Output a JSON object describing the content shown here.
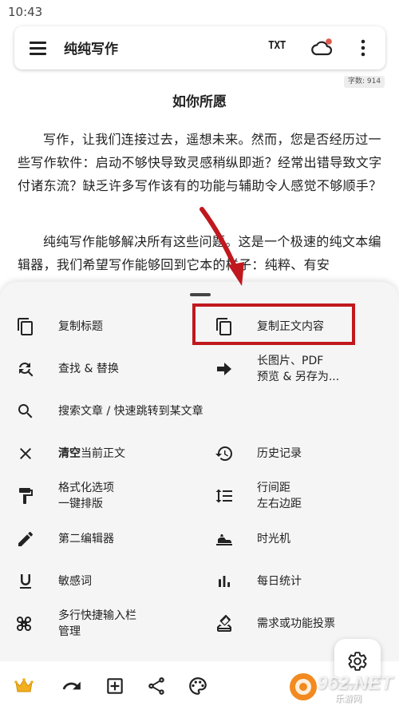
{
  "status_bar": {
    "time": "10:43"
  },
  "toolbar": {
    "title": "纯纯写作",
    "txt_label": "TXT",
    "cloud_has_notification": true,
    "notification_color": "#e05a4e"
  },
  "editor": {
    "word_count": "字数: 914",
    "title": "如你所愿",
    "paragraphs": [
      "写作，让我们连接过去，遥想未来。然而，您是否经历过一些写作软件：启动不够快导致灵感稍纵即逝？经常出错导致文字付诸东流？缺乏许多写作该有的功能与辅助令人感觉不够顺手？",
      "纯纯写作能够解决所有这些问题。这是一个极速的纯文本编辑器，我们希望写作能够回到它本的样子：纯粹、有安"
    ]
  },
  "menu": {
    "items": [
      {
        "icon": "copy-icon",
        "label": "复制标题"
      },
      {
        "icon": "copy-icon",
        "label": "复制正文内容"
      },
      {
        "icon": "find-replace-icon",
        "label": "查找 & 替换"
      },
      {
        "icon": "arrow-right-icon",
        "label": "长图片、PDF\n预览 & 另存为..."
      },
      {
        "icon": "search-icon",
        "label": "搜索文章 / 快速跳转到某文章"
      },
      {
        "icon": "close-icon",
        "label_bold": "清空",
        "label": "当前正文"
      },
      {
        "icon": "history-icon",
        "label": "历史记录"
      },
      {
        "icon": "paint-roller-icon",
        "label": "格式化选项\n一键排版"
      },
      {
        "icon": "line-spacing-icon",
        "label": "行间距\n左右边距"
      },
      {
        "icon": "pencil-icon",
        "label": "第二编辑器"
      },
      {
        "icon": "time-machine-icon",
        "label": "时光机"
      },
      {
        "icon": "underline-icon",
        "label": "敏感词"
      },
      {
        "icon": "bar-chart-icon",
        "label": "每日统计"
      },
      {
        "icon": "command-icon",
        "label": "多行快捷输入栏\n管理"
      },
      {
        "icon": "vote-icon",
        "label": "需求或功能投票"
      }
    ]
  },
  "highlight_color": "#c0181e",
  "bottom_bar": {
    "icons": [
      "crown-icon",
      "redo-icon",
      "add-box-icon",
      "share-icon",
      "palette-icon"
    ]
  },
  "watermark": {
    "text": "962.NET",
    "sub": "乐游网"
  }
}
